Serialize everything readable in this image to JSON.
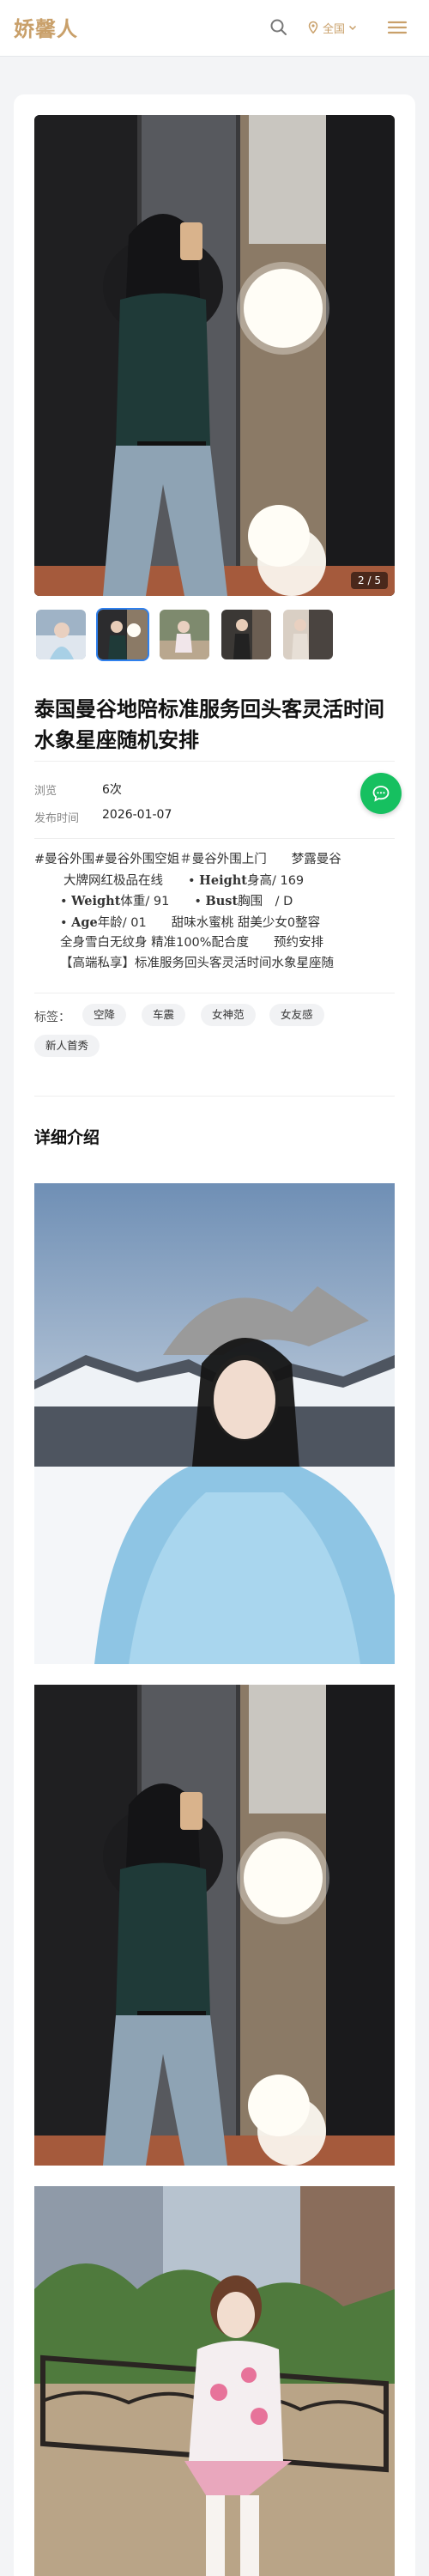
{
  "header": {
    "logo": "娇馨人",
    "location_label": "全国",
    "icons": [
      "search-icon",
      "location-pin-icon",
      "chevron-down-icon",
      "menu-icon"
    ]
  },
  "gallery": {
    "counter": "2 / 5",
    "thumbnail_count": 5,
    "active_index": 2
  },
  "post": {
    "title": "泰国曼谷地陪标准服务回头客灵活时间水象星座随机安排",
    "meta": {
      "views_label": "浏览",
      "views_value": "6次",
      "date_label": "发布时间",
      "date_value": "2026-01-07"
    },
    "description": {
      "line1": "#曼谷外围#曼谷外围空姐＃曼谷外围上门　　梦露曼谷",
      "line2": "大牌网红极品在线　　•",
      "height_label": "Height",
      "height_value": "身高/ 169",
      "bullet_weight": "•",
      "weight_label": "Weight",
      "weight_value": "体重/ 91　　•",
      "bust_label": "Bust",
      "bust_value": "胸围　/ D",
      "bullet_age": "•",
      "age_label": "Age",
      "age_value": "年龄/ 01　　甜味水蜜桃 甜美少女0整容",
      "line6": "全身雪白无纹身 精准100%配合度　　预约安排",
      "line7": "【高端私享】标准服务回头客灵活时间水象星座随"
    },
    "tags_label": "标签：",
    "tags": [
      "空降",
      "车震",
      "女神范",
      "女友感",
      "新人首秀"
    ]
  },
  "details": {
    "section_title": "详细介绍"
  },
  "colors": {
    "brand": "#c9a06a",
    "accent_blue": "#2f80ed",
    "chat_green": "#16c060"
  }
}
